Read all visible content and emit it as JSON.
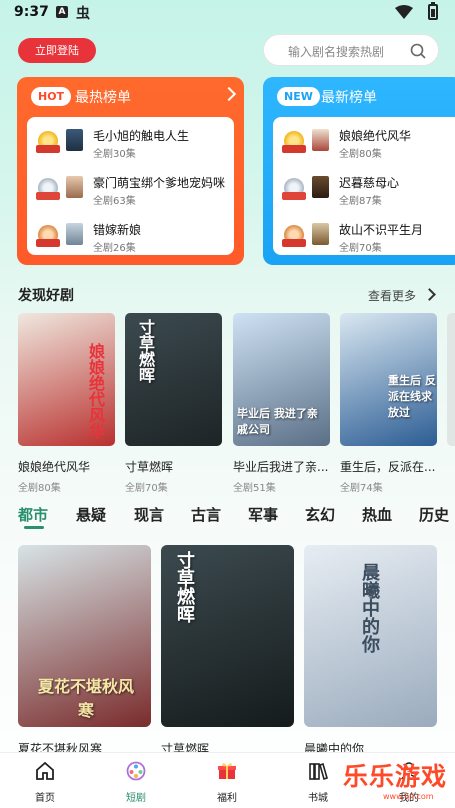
{
  "status_bar": {
    "time": "9:37",
    "notif_a": "A",
    "notif_app": "虫"
  },
  "header": {
    "login_label": "立即登陆",
    "search_placeholder": "输入剧名搜索热剧"
  },
  "rank_hot": {
    "badge": "HOT",
    "title": "最热榜单",
    "items": [
      {
        "name": "毛小旭的触电人生",
        "eps": "全剧30集",
        "medal": "gold"
      },
      {
        "name": "豪门萌宝绑个爹地宠妈咪",
        "eps": "全剧63集",
        "medal": "silver"
      },
      {
        "name": "错嫁新娘",
        "eps": "全剧26集",
        "medal": "bronze"
      }
    ]
  },
  "rank_new": {
    "badge": "NEW",
    "title": "最新榜单",
    "items": [
      {
        "name": "娘娘绝代风华",
        "eps": "全剧80集",
        "medal": "gold"
      },
      {
        "name": "迟暮慈母心",
        "eps": "全剧87集",
        "medal": "silver"
      },
      {
        "name": "故山不识平生月",
        "eps": "全剧70集",
        "medal": "bronze"
      }
    ]
  },
  "discover": {
    "title": "发现好剧",
    "see_more": "查看更多",
    "items": [
      {
        "title": "娘娘绝代风华",
        "eps": "全剧80集",
        "color1": "#efe8df",
        "color2": "#b9302e",
        "caption": "娘娘绝代风华"
      },
      {
        "title": "寸草燃晖",
        "eps": "全剧70集",
        "color1": "#3c4a4f",
        "color2": "#1d2426",
        "caption": "寸草燃晖"
      },
      {
        "title": "毕业后我进了亲...",
        "eps": "全剧51集",
        "color1": "#cfe2f4",
        "color2": "#5a6f86",
        "caption": "毕业后 我进了亲戚公司"
      },
      {
        "title": "重生后，反派在...",
        "eps": "全剧74集",
        "color1": "#d9e7f1",
        "color2": "#2c5d94",
        "caption": "重生后 反派在线求放过"
      }
    ]
  },
  "categories": [
    "都市",
    "悬疑",
    "现言",
    "古言",
    "军事",
    "玄幻",
    "热血",
    "历史"
  ],
  "active_category": "都市",
  "featured": [
    {
      "title": "夏花不堪秋风寒",
      "color1": "#d7e3e6",
      "color2": "#7a2b2b",
      "caption": "夏花不堪秋风寒"
    },
    {
      "title": "寸草燃晖",
      "color1": "#3c4a4f",
      "color2": "#151b1c",
      "caption": "寸草燃晖"
    },
    {
      "title": "晨曦中的你",
      "color1": "#e7edf3",
      "color2": "#9aabbd",
      "caption": "晨曦中的你"
    }
  ],
  "bottom_nav": [
    {
      "label": "首页",
      "icon": "home-icon"
    },
    {
      "label": "短剧",
      "icon": "film-reel-icon",
      "active": true
    },
    {
      "label": "福利",
      "icon": "gift-icon"
    },
    {
      "label": "书城",
      "icon": "books-icon"
    },
    {
      "label": "我的",
      "icon": "profile-icon"
    }
  ],
  "watermark": {
    "text": "乐乐游戏",
    "url": "www.6li.com"
  }
}
